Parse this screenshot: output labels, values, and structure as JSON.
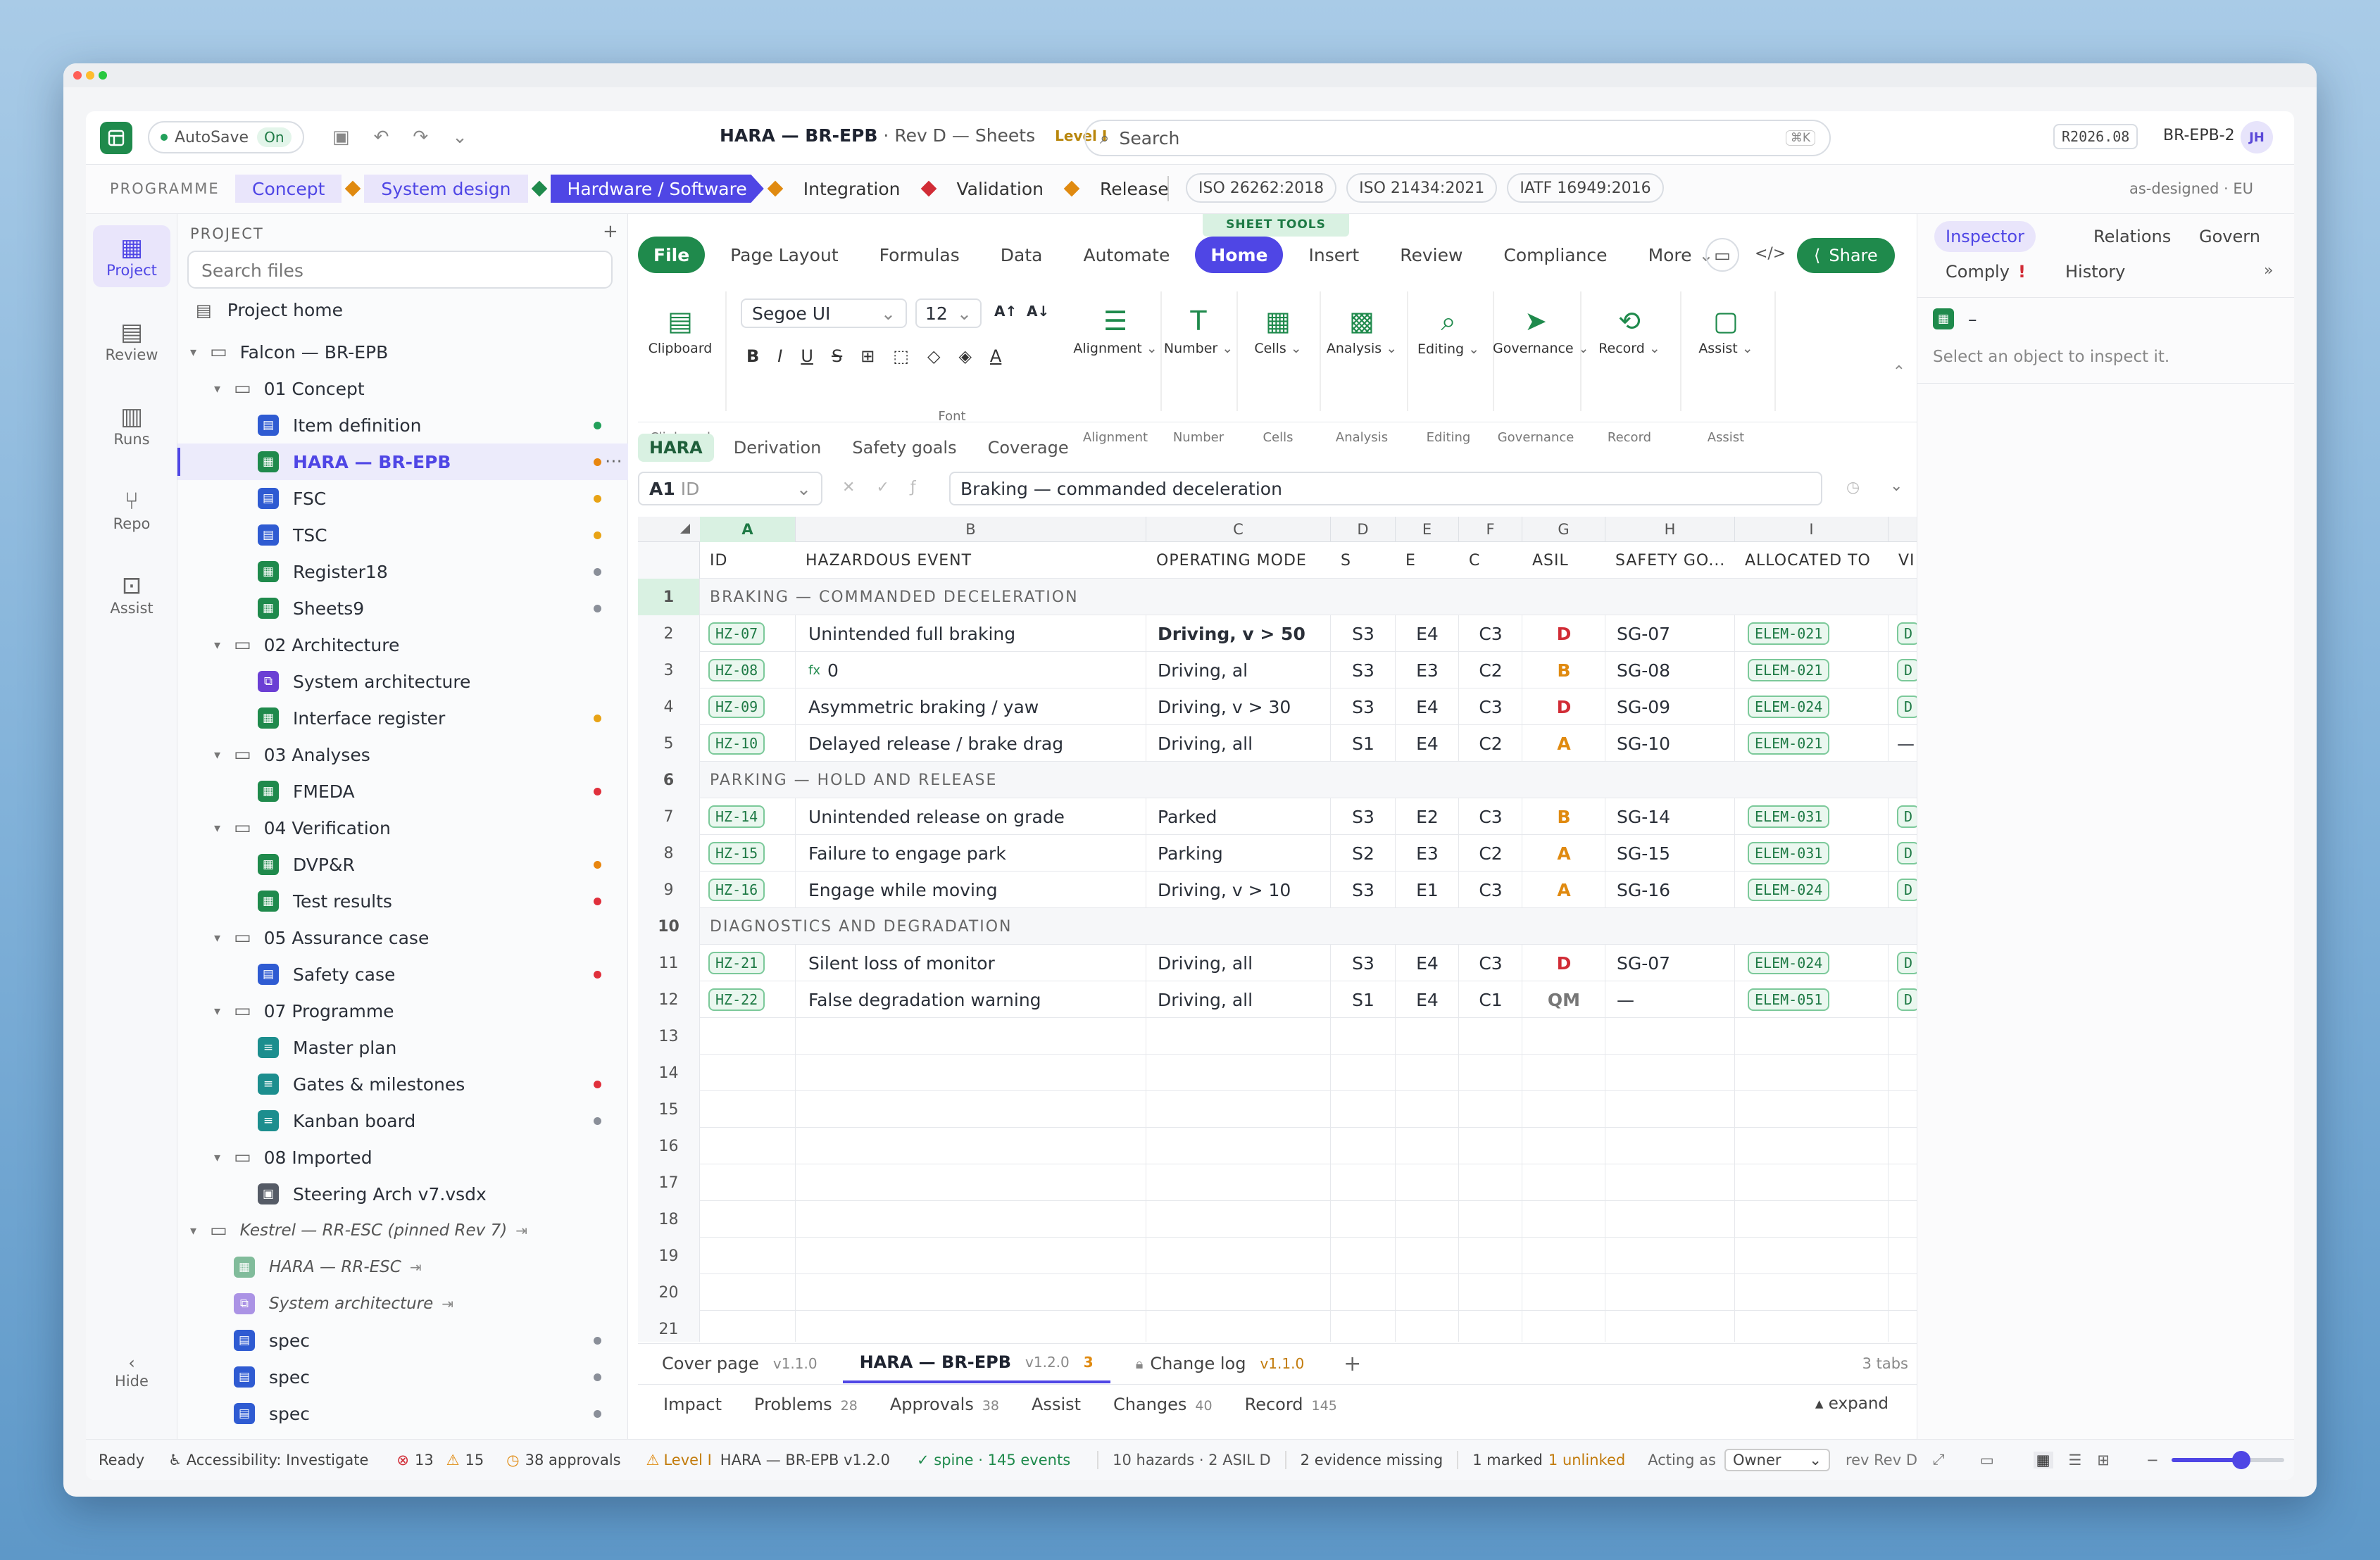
{
  "app": {
    "title": "HARA — BR-EPB",
    "subtitle": "· Rev D — Sheets",
    "level": "Level I",
    "autosave": "AutoSave",
    "autosave_state": "On",
    "search_placeholder": "Search",
    "search_shortcut": "⌘K",
    "release": "R2026.08",
    "project_code": "BR-EPB-2",
    "avatar": "JH"
  },
  "programme": {
    "label": "PROGRAMME",
    "phases": [
      "Concept",
      "System design",
      "Hardware / Software",
      "Integration",
      "Validation",
      "Release"
    ],
    "standards": [
      "ISO 26262:2018",
      "ISO 21434:2021",
      "IATF 16949:2016"
    ],
    "context": "as-designed · EU"
  },
  "leftnav": [
    {
      "label": "Project",
      "icon": "grid-icon"
    },
    {
      "label": "Review",
      "icon": "clipboard-icon"
    },
    {
      "label": "Runs",
      "icon": "chart-icon"
    },
    {
      "label": "Repo",
      "icon": "branch-icon"
    },
    {
      "label": "Assist",
      "icon": "robot-icon"
    }
  ],
  "leftnav_hide": "Hide",
  "files": {
    "header": "PROJECT",
    "add": "+",
    "search_placeholder": "Search files",
    "home": "Project home",
    "tree": [
      {
        "label": "Falcon — BR-EPB",
        "type": "folder",
        "level": 0,
        "chev": "▾"
      },
      {
        "label": "01 Concept",
        "type": "folder",
        "level": 1,
        "chev": "▾"
      },
      {
        "label": "Item definition",
        "type": "doc",
        "level": 2,
        "status": "#22a05a"
      },
      {
        "label": "HARA — BR-EPB",
        "type": "sheet",
        "level": 2,
        "status": "#e8860f",
        "selected": true
      },
      {
        "label": "FSC",
        "type": "doc",
        "level": 2,
        "status": "#e8a315"
      },
      {
        "label": "TSC",
        "type": "doc",
        "level": 2,
        "status": "#e8a315"
      },
      {
        "label": "Register18",
        "type": "sheet",
        "level": 2,
        "status": "#8a8f99"
      },
      {
        "label": "Sheets9",
        "type": "sheet",
        "level": 2,
        "status": "#8a8f99"
      },
      {
        "label": "02 Architecture",
        "type": "folder",
        "level": 1,
        "chev": "▾"
      },
      {
        "label": "System architecture",
        "type": "diagram",
        "level": 2
      },
      {
        "label": "Interface register",
        "type": "sheet",
        "level": 2,
        "status": "#e8a315"
      },
      {
        "label": "03 Analyses",
        "type": "folder",
        "level": 1,
        "chev": "▾"
      },
      {
        "label": "FMEDA",
        "type": "sheet",
        "level": 2,
        "status": "#e0303c"
      },
      {
        "label": "04 Verification",
        "type": "folder",
        "level": 1,
        "chev": "▾"
      },
      {
        "label": "DVP&R",
        "type": "sheet",
        "level": 2,
        "status": "#e8860f"
      },
      {
        "label": "Test results",
        "type": "sheet",
        "level": 2,
        "status": "#e0303c"
      },
      {
        "label": "05 Assurance case",
        "type": "folder",
        "level": 1,
        "chev": "▾"
      },
      {
        "label": "Safety case",
        "type": "doc",
        "level": 2,
        "status": "#e0303c"
      },
      {
        "label": "07 Programme",
        "type": "folder",
        "level": 1,
        "chev": "▾"
      },
      {
        "label": "Master plan",
        "type": "plan",
        "level": 2
      },
      {
        "label": "Gates & milestones",
        "type": "plan",
        "level": 2,
        "status": "#e0303c"
      },
      {
        "label": "Kanban board",
        "type": "plan",
        "level": 2,
        "status": "#8a8f99"
      },
      {
        "label": "08 Imported",
        "type": "folder",
        "level": 1,
        "chev": "▾"
      },
      {
        "label": "Steering Arch v7.vsdx",
        "type": "import",
        "level": 2
      },
      {
        "label": "Kestrel — RR-ESC (pinned Rev 7)",
        "type": "folder",
        "level": 0,
        "chev": "▾",
        "italic": true,
        "link": "⇥"
      },
      {
        "label": "HARA — RR-ESC",
        "type": "sheet",
        "level": 1,
        "italic": true,
        "link": "⇥"
      },
      {
        "label": "System architecture",
        "type": "diagram",
        "level": 1,
        "italic": true,
        "link": "⇥"
      },
      {
        "label": "spec",
        "type": "doc",
        "level": 1,
        "status": "#8a8f99"
      },
      {
        "label": "spec",
        "type": "doc",
        "level": 1,
        "status": "#8a8f99"
      },
      {
        "label": "spec",
        "type": "doc",
        "level": 1,
        "status": "#8a8f99"
      }
    ]
  },
  "sheet_tools": "SHEET TOOLS",
  "ribbon_tabs": [
    "File",
    "Page Layout",
    "Formulas",
    "Data",
    "Automate",
    "Home",
    "Insert",
    "Review",
    "Compliance",
    "More"
  ],
  "share": "Share",
  "code_icon": "</>",
  "font": {
    "name": "Segoe UI",
    "size": "12",
    "grow": "A↑",
    "shrink": "A↓"
  },
  "ribbon_groups": [
    {
      "label": "Clipboard",
      "group": "Clipboard",
      "icon": "clipboard-icon"
    },
    {
      "label": "Alignment",
      "group": "Alignment",
      "icon": "align-icon"
    },
    {
      "label": "Number",
      "group": "Number",
      "icon": "number-icon"
    },
    {
      "label": "Cells",
      "group": "Cells",
      "icon": "cells-icon"
    },
    {
      "label": "Analysis",
      "group": "Analysis",
      "icon": "analysis-icon"
    },
    {
      "label": "Editing",
      "group": "Editing",
      "icon": "search-icon"
    },
    {
      "label": "Governance",
      "group": "Governance",
      "icon": "send-icon"
    },
    {
      "label": "Record",
      "group": "Record",
      "icon": "history-icon"
    },
    {
      "label": "Assist",
      "group": "Assist",
      "icon": "square-icon"
    }
  ],
  "font_group": "Font",
  "subtabs": [
    "HARA",
    "Derivation",
    "Safety goals",
    "Coverage"
  ],
  "formula": {
    "ref": "A1",
    "ref_name": "ID",
    "value": "Braking — commanded deceleration"
  },
  "columns": [
    {
      "letter": "A",
      "header": "ID"
    },
    {
      "letter": "B",
      "header": "HAZARDOUS EVENT"
    },
    {
      "letter": "C",
      "header": "OPERATING MODE"
    },
    {
      "letter": "D",
      "header": "S"
    },
    {
      "letter": "E",
      "header": "E"
    },
    {
      "letter": "F",
      "header": "C"
    },
    {
      "letter": "G",
      "header": "ASIL"
    },
    {
      "letter": "H",
      "header": "SAFETY GO..."
    },
    {
      "letter": "I",
      "header": "ALLOCATED TO"
    },
    {
      "letter": "",
      "header": "VI"
    }
  ],
  "rows": [
    {
      "n": "1",
      "section": "BRAKING — COMMANDED DECELERATION"
    },
    {
      "n": "2",
      "id": "HZ-07",
      "event": "Unintended full braking",
      "mode": "Driving, v > 50",
      "mode_bold": true,
      "s": "S3",
      "e": "E4",
      "c": "C3",
      "asil": "D",
      "goal": "SG-07",
      "alloc": "ELEM-021",
      "v": "D"
    },
    {
      "n": "3",
      "id": "HZ-08",
      "event": "0",
      "fx": "fx",
      "mode": "Driving, al",
      "s": "S3",
      "e": "E3",
      "c": "C2",
      "asil": "B",
      "goal": "SG-08",
      "alloc": "ELEM-021",
      "v": "D"
    },
    {
      "n": "4",
      "id": "HZ-09",
      "event": "Asymmetric braking / yaw",
      "mode": "Driving, v > 30",
      "s": "S3",
      "e": "E4",
      "c": "C3",
      "asil": "D",
      "goal": "SG-09",
      "alloc": "ELEM-024",
      "v": "D"
    },
    {
      "n": "5",
      "id": "HZ-10",
      "event": "Delayed release / brake drag",
      "mode": "Driving, all",
      "s": "S1",
      "e": "E4",
      "c": "C2",
      "asil": "A",
      "goal": "SG-10",
      "alloc": "ELEM-021",
      "v": "—"
    },
    {
      "n": "6",
      "section": "PARKING — HOLD AND RELEASE"
    },
    {
      "n": "7",
      "id": "HZ-14",
      "event": "Unintended release on grade",
      "mode": "Parked",
      "s": "S3",
      "e": "E2",
      "c": "C3",
      "asil": "B",
      "goal": "SG-14",
      "alloc": "ELEM-031",
      "v": "D"
    },
    {
      "n": "8",
      "id": "HZ-15",
      "event": "Failure to engage park",
      "mode": "Parking",
      "s": "S2",
      "e": "E3",
      "c": "C2",
      "asil": "A",
      "goal": "SG-15",
      "alloc": "ELEM-031",
      "v": "D"
    },
    {
      "n": "9",
      "id": "HZ-16",
      "event": "Engage while moving",
      "mode": "Driving, v > 10",
      "s": "S3",
      "e": "E1",
      "c": "C3",
      "asil": "A",
      "goal": "SG-16",
      "alloc": "ELEM-024",
      "v": "D"
    },
    {
      "n": "10",
      "section": "DIAGNOSTICS AND DEGRADATION"
    },
    {
      "n": "11",
      "id": "HZ-21",
      "event": "Silent loss of monitor",
      "mode": "Driving, all",
      "s": "S3",
      "e": "E4",
      "c": "C3",
      "asil": "D",
      "goal": "SG-07",
      "alloc": "ELEM-024",
      "v": "D"
    },
    {
      "n": "12",
      "id": "HZ-22",
      "event": "False degradation warning",
      "mode": "Driving, all",
      "s": "S1",
      "e": "E4",
      "c": "C1",
      "asil": "QM",
      "goal": "—",
      "alloc": "ELEM-051",
      "v": "D"
    },
    {
      "n": "13"
    },
    {
      "n": "14"
    },
    {
      "n": "15"
    },
    {
      "n": "16"
    },
    {
      "n": "17"
    },
    {
      "n": "18"
    },
    {
      "n": "19"
    },
    {
      "n": "20"
    },
    {
      "n": "21"
    }
  ],
  "asil_colors": {
    "D": "#d12c36",
    "B": "#e08a10",
    "A": "#e08a10",
    "QM": "#777777"
  },
  "sheet_tabs": [
    {
      "label": "Cover page",
      "ver": "v1.1.0"
    },
    {
      "label": "HARA — BR-EPB",
      "ver": "v1.2.0",
      "badge": "3",
      "active": true
    },
    {
      "label": "Change log",
      "ver": "v1.1.0",
      "lock": true
    }
  ],
  "tabs_count": "3 tabs",
  "bottom_panel": [
    {
      "label": "Impact"
    },
    {
      "label": "Problems",
      "count": "28"
    },
    {
      "label": "Approvals",
      "count": "38"
    },
    {
      "label": "Assist"
    },
    {
      "label": "Changes",
      "count": "40"
    },
    {
      "label": "Record",
      "count": "145"
    }
  ],
  "expand": "▴ expand",
  "inspector": {
    "tabs": [
      "Inspector",
      "Relations",
      "Govern",
      "Comply",
      "History"
    ],
    "comply_flag": "!",
    "more": "»",
    "title": "–",
    "hint": "Select an object to inspect it."
  },
  "status": {
    "ready": "Ready",
    "accessibility": "Accessibility: Investigate",
    "errors": "13",
    "warnings": "15",
    "approvals": "38 approvals",
    "level": "Level I",
    "doc": "HARA — BR-EPB v1.2.0",
    "spine": "✓ spine · 145 events",
    "hazards": "10 hazards · 2 ASIL D",
    "evidence": "2 evidence missing",
    "marked": "1 marked",
    "unlinked": "1 unlinked",
    "acting": "Acting as",
    "role": "Owner",
    "rev": "rev Rev D",
    "zoom": 0.62
  }
}
